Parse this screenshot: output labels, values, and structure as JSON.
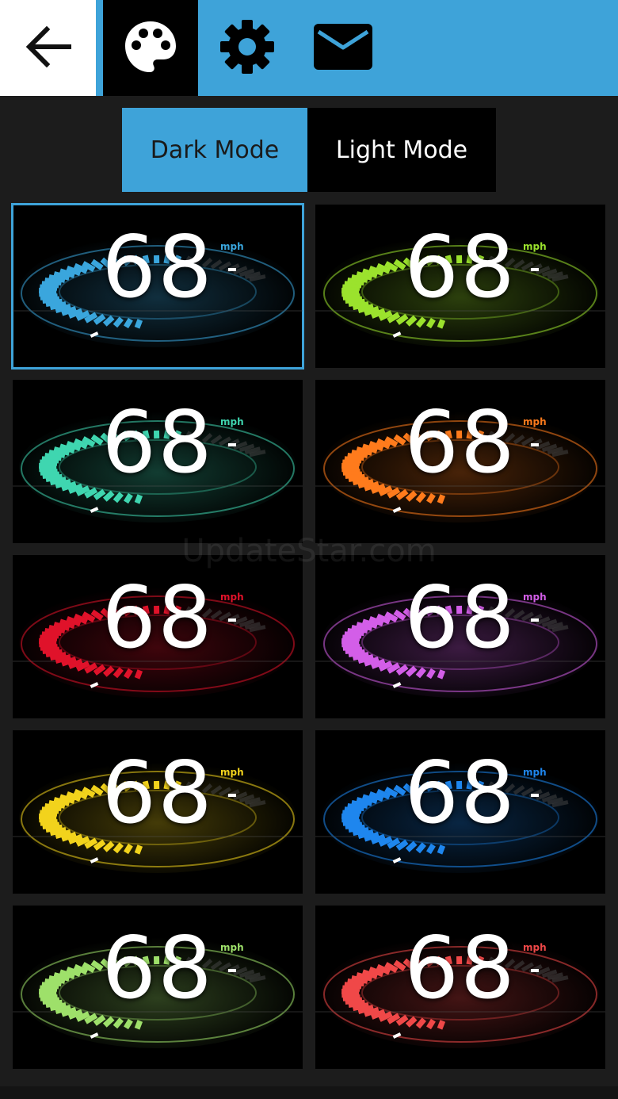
{
  "toolbar": {
    "back_icon": "arrow-left-icon",
    "palette_icon": "palette-icon",
    "settings_icon": "gear-icon",
    "mail_icon": "mail-icon",
    "accent": "#3ea3d9"
  },
  "mode": {
    "dark_label": "Dark Mode",
    "light_label": "Light Mode",
    "selected": "Dark Mode"
  },
  "themes": [
    {
      "speed": "68",
      "unit": "mph",
      "color": "#3aa6dd",
      "selected": true
    },
    {
      "speed": "68",
      "unit": "mph",
      "color": "#9be22d",
      "selected": false
    },
    {
      "speed": "68",
      "unit": "mph",
      "color": "#3fd6b0",
      "selected": false
    },
    {
      "speed": "68",
      "unit": "mph",
      "color": "#ff7b1c",
      "selected": false
    },
    {
      "speed": "68",
      "unit": "mph",
      "color": "#e0122a",
      "selected": false
    },
    {
      "speed": "68",
      "unit": "mph",
      "color": "#d35ee8",
      "selected": false
    },
    {
      "speed": "68",
      "unit": "mph",
      "color": "#f2d31c",
      "selected": false
    },
    {
      "speed": "68",
      "unit": "mph",
      "color": "#1e86ee",
      "selected": false
    },
    {
      "speed": "68",
      "unit": "mph",
      "color": "#9ee06a",
      "selected": false
    },
    {
      "speed": "68",
      "unit": "mph",
      "color": "#f04848",
      "selected": false
    }
  ],
  "watermark": "UpdateStar.com"
}
